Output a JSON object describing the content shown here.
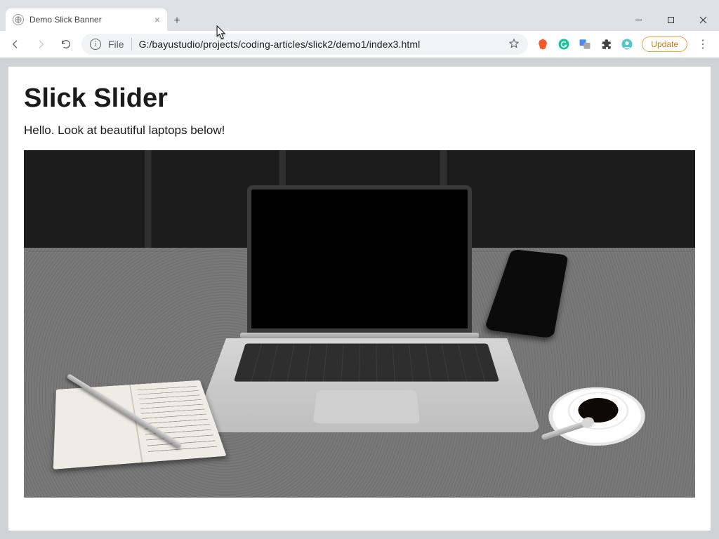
{
  "browser": {
    "tab": {
      "title": "Demo Slick Banner"
    },
    "address": {
      "scheme": "File",
      "path": "G:/bayustudio/projects/coding-articles/slick2/demo1/index3.html"
    },
    "update_label": "Update"
  },
  "page": {
    "heading": "Slick Slider",
    "intro": "Hello. Look at beautiful laptops below!"
  }
}
